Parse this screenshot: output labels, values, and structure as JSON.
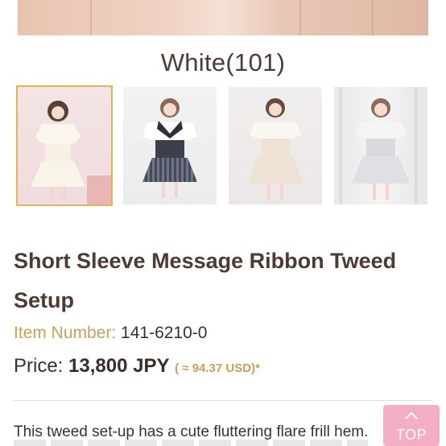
{
  "product": {
    "color_name": "White(101)",
    "title": "Short Sleeve Message Ribbon Tweed Setup",
    "item_number_label": "Item Number:",
    "item_number": "141-6210-0",
    "price_label": "Price:",
    "price_value": "13,800 JPY",
    "price_usd": "( ≈ 94.37 USD)*",
    "description": "This tweed set-up has a cute fluttering flare frill hem."
  },
  "thumbnails": [
    {
      "name": "white",
      "selected": true
    },
    {
      "name": "navy-check",
      "selected": false
    },
    {
      "name": "beige",
      "selected": false
    },
    {
      "name": "grey",
      "selected": false
    }
  ],
  "top_button": {
    "label": "TOP",
    "icon": "chevron-up-icon"
  },
  "colors": {
    "title": "#4f3a33",
    "accent_gold": "#c9a055",
    "selected_border": "#e3b455",
    "top_button_bg": "#f4aec3"
  }
}
